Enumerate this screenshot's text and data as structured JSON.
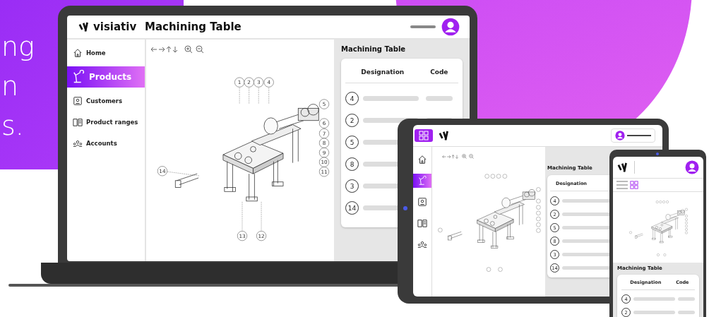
{
  "background_text": [
    "ng",
    "n",
    "s."
  ],
  "laptop": {
    "logo": "visiativ",
    "title": "Machining Table",
    "nav": [
      {
        "label": "Home",
        "selected": false
      },
      {
        "label": "Products",
        "selected": true
      },
      {
        "label": "Customers",
        "selected": false
      },
      {
        "label": "Product ranges",
        "selected": false
      },
      {
        "label": "Accounts",
        "selected": false
      }
    ],
    "callouts": [
      "1",
      "2",
      "3",
      "4",
      "5",
      "6",
      "7",
      "8",
      "9",
      "10",
      "11",
      "12",
      "13",
      "14"
    ],
    "panel": {
      "title": "Machining Table",
      "columns": [
        "Designation",
        "Code"
      ],
      "rows": [
        "4",
        "2",
        "5",
        "8",
        "3",
        "14"
      ]
    }
  },
  "tablet": {
    "nav": [
      {
        "selected": false
      },
      {
        "selected": true
      },
      {
        "selected": false
      },
      {
        "selected": false
      },
      {
        "selected": false
      }
    ],
    "panel": {
      "title": "Machining Table",
      "columns": [
        "Designation"
      ],
      "rows": [
        "4",
        "2",
        "5",
        "8",
        "3",
        "14"
      ]
    }
  },
  "phone": {
    "panel": {
      "title": "Machining Table",
      "columns": [
        "Designation",
        "Code"
      ],
      "rows": [
        "4",
        "2"
      ]
    }
  }
}
